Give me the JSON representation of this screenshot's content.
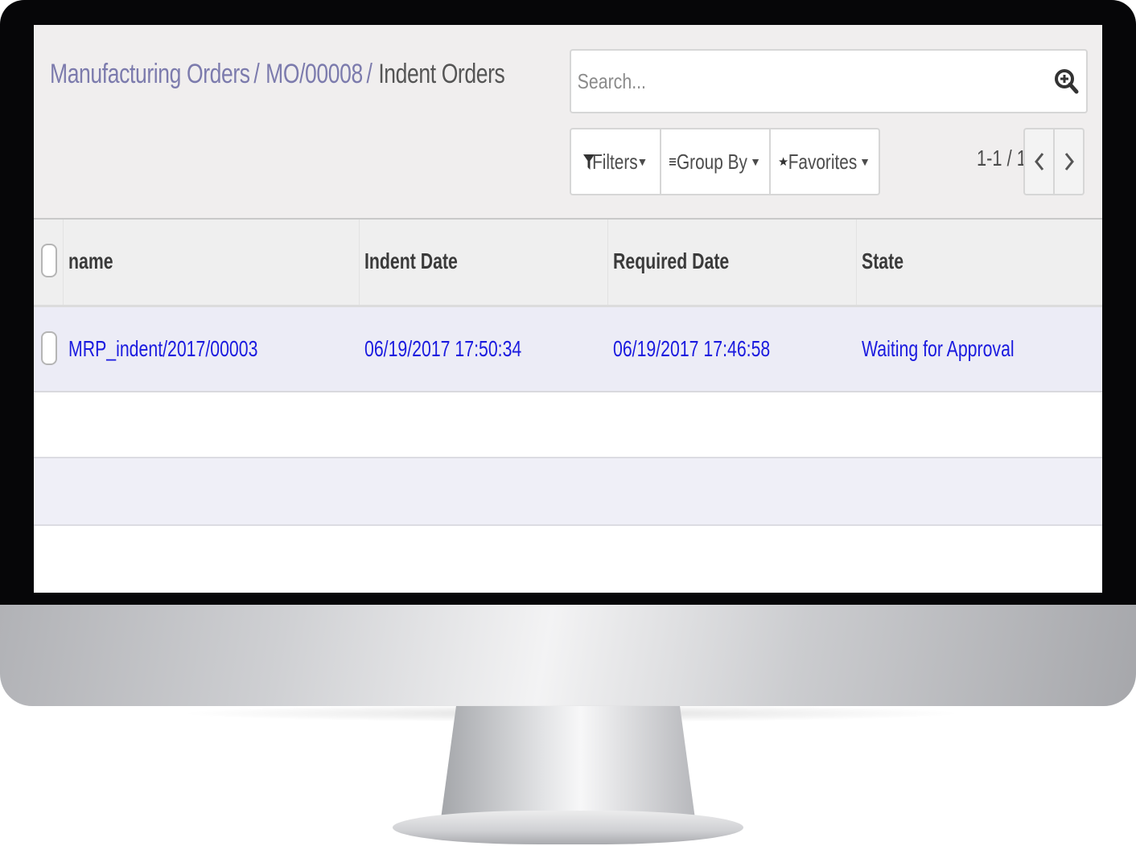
{
  "breadcrumb": {
    "items": [
      "Manufacturing Orders",
      "MO/00008",
      "Indent Orders"
    ],
    "separator": "/"
  },
  "search": {
    "placeholder": "Search...",
    "icon": "search-icon"
  },
  "toolbar": {
    "filters_label": "Filters",
    "groupby_label": "Group By",
    "favorites_label": "Favorites"
  },
  "pager": {
    "value": "1-1 / 1"
  },
  "table": {
    "columns": [
      "name",
      "Indent Date",
      "Required Date",
      "State"
    ],
    "rows": [
      {
        "name": "MRP_indent/2017/00003",
        "indent_date": "06/19/2017 17:50:34",
        "required_date": "06/19/2017 17:46:58",
        "state": "Waiting for Approval"
      }
    ]
  },
  "colors": {
    "breadcrumb_link": "#7c7bad",
    "row_link": "#1a1adf",
    "control_panel_bg": "#f0eeee",
    "selected_row_bg": "#ececf6"
  }
}
